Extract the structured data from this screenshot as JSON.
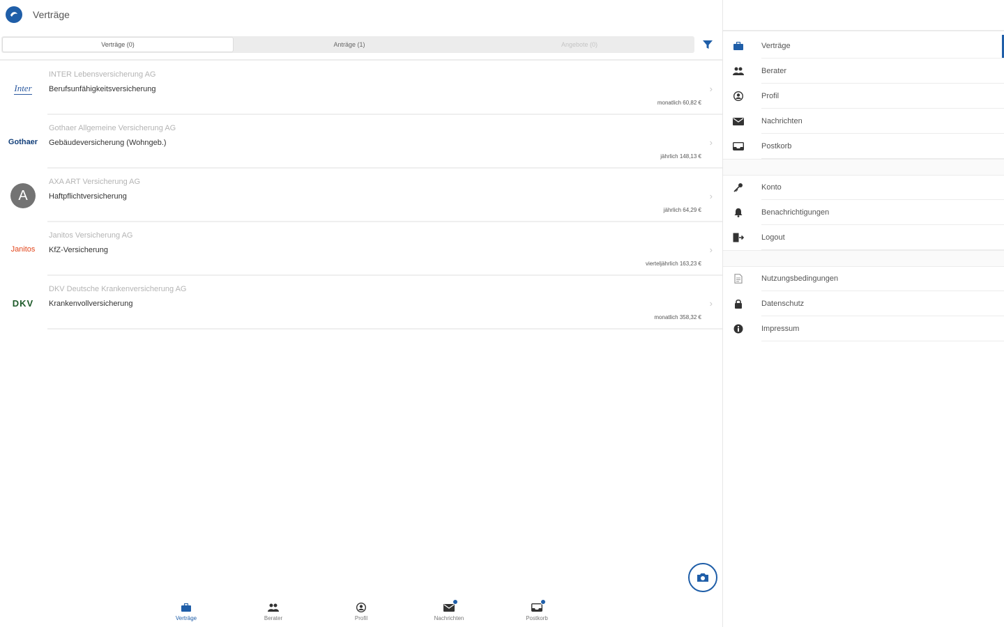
{
  "header": {
    "title": "Verträge"
  },
  "tabs": [
    {
      "label": "Verträge (0)",
      "state": "active"
    },
    {
      "label": "Anträge (1)",
      "state": "normal"
    },
    {
      "label": "Angebote (0)",
      "state": "disabled"
    }
  ],
  "contracts": [
    {
      "logo": "Inter",
      "company": "INTER Lebensversicherung AG",
      "type": "Berufsunfähigkeitsversicherung",
      "price": "monatlich 60,82 €"
    },
    {
      "logo": "Gothaer",
      "company": "Gothaer Allgemeine Versicherung AG",
      "type": "Gebäudeversicherung (Wohngeb.)",
      "price": "jährlich 148,13 €"
    },
    {
      "logo": "A",
      "company": "AXA ART Versicherung AG",
      "type": "Haftpflichtversicherung",
      "price": "jährlich 64,29 €"
    },
    {
      "logo": "Janitos",
      "company": "Janitos Versicherung AG",
      "type": "KfZ-Versicherung",
      "price": "vierteljährlich 163,23 €"
    },
    {
      "logo": "DKV",
      "company": "DKV Deutsche Krankenversicherung AG",
      "type": "Krankenvollversicherung",
      "price": "monatlich 358,32 €"
    }
  ],
  "bottom_nav": [
    {
      "label": "Verträge",
      "icon": "briefcase-icon",
      "active": true
    },
    {
      "label": "Berater",
      "icon": "people-icon",
      "active": false
    },
    {
      "label": "Profil",
      "icon": "person-icon",
      "active": false
    },
    {
      "label": "Nachrichten",
      "icon": "mail-icon",
      "active": false,
      "badge": true
    },
    {
      "label": "Postkorb",
      "icon": "inbox-icon",
      "active": false,
      "badge": true
    }
  ],
  "side_menu": {
    "group1": [
      {
        "label": "Verträge",
        "icon": "briefcase-icon",
        "active": true
      },
      {
        "label": "Berater",
        "icon": "people-icon"
      },
      {
        "label": "Profil",
        "icon": "person-icon"
      },
      {
        "label": "Nachrichten",
        "icon": "mail-icon"
      },
      {
        "label": "Postkorb",
        "icon": "inbox-icon"
      }
    ],
    "group2": [
      {
        "label": "Konto",
        "icon": "key-icon"
      },
      {
        "label": "Benachrichtigungen",
        "icon": "bell-icon"
      },
      {
        "label": "Logout",
        "icon": "logout-icon"
      }
    ],
    "group3": [
      {
        "label": "Nutzungsbedingungen",
        "icon": "document-icon"
      },
      {
        "label": "Datenschutz",
        "icon": "lock-icon"
      },
      {
        "label": "Impressum",
        "icon": "info-icon"
      }
    ]
  },
  "colors": {
    "accent": "#1f5ea8",
    "divider": "#ececec",
    "muted_text": "#b4b4b4"
  }
}
